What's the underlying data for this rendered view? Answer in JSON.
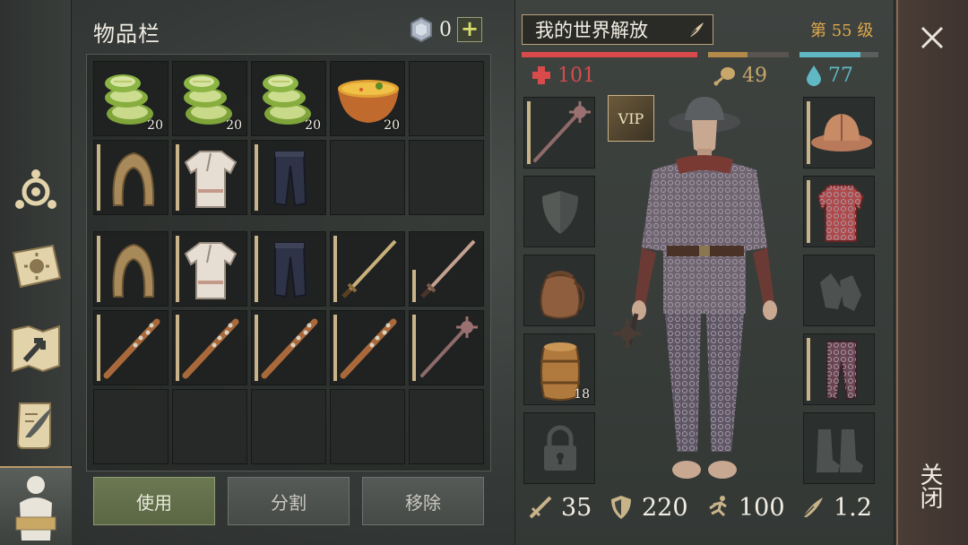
{
  "inventory": {
    "title": "物品栏",
    "coins": "0",
    "plus_label": "+",
    "rows": [
      [
        {
          "item": "cucumber-slices-icon",
          "qty": "20"
        },
        {
          "item": "cucumber-slices-icon",
          "qty": "20"
        },
        {
          "item": "cucumber-slices-icon",
          "qty": "20"
        },
        {
          "item": "soup-bowl-icon",
          "qty": "20"
        },
        {
          "item": "empty",
          "qty": ""
        }
      ],
      [
        {
          "item": "hood-icon",
          "qty": ""
        },
        {
          "item": "shirt-icon",
          "qty": ""
        },
        {
          "item": "pants-icon",
          "qty": ""
        },
        {
          "item": "empty",
          "qty": ""
        },
        {
          "item": "empty",
          "qty": ""
        }
      ]
    ],
    "actions": {
      "use": "使用",
      "split": "分割",
      "remove": "移除"
    }
  },
  "character": {
    "name": "我的世界解放",
    "level": "第 55 级",
    "health": "101",
    "food": "49",
    "water": "77",
    "vip": "VIP",
    "arrows_qty": "18",
    "stats": {
      "attack": "35",
      "armor": "220",
      "speed": "100",
      "weight": "1.2"
    }
  },
  "close": {
    "label": "关闭"
  },
  "colors": {
    "health": "#d94b4b",
    "food": "#b48a4a",
    "water": "#5fb8c4",
    "level": "#e0a84a",
    "accent": "#c9b48a"
  }
}
